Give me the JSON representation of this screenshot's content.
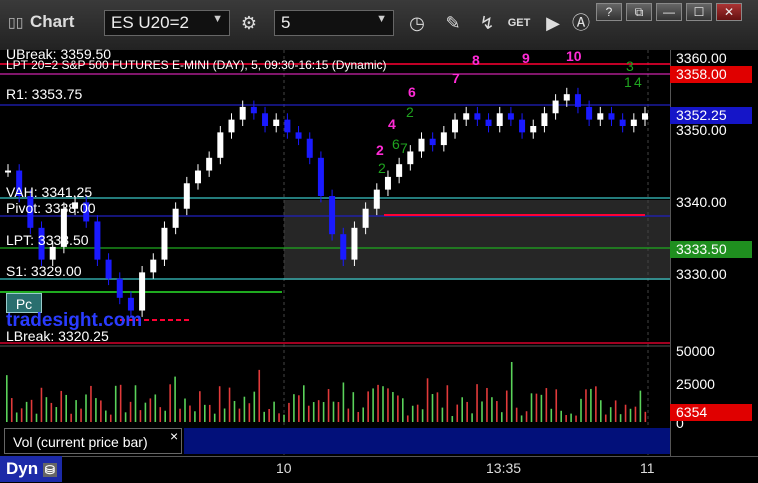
{
  "window": {
    "title": "Chart",
    "symbol": "ES U20=2",
    "interval": "5"
  },
  "toolbar_icons": [
    "settings-icon",
    "clock-icon",
    "pencil-icon",
    "indicator-icon",
    "get-icon",
    "play-icon",
    "alert-icon"
  ],
  "window_buttons": [
    "restore-icon",
    "pin-icon",
    "maximize-icon",
    "close-icon"
  ],
  "colors": {
    "background": "#000000",
    "up_bar": "#ffffff",
    "down_bar": "#1a1aff",
    "level_blue": "#2020c0",
    "level_cyan": "#39c6c6",
    "level_red": "#ff0033",
    "level_green": "#1faa1f",
    "magenta": "#ff2bd6",
    "green_count": "#1fa31f"
  },
  "header_text": "LPT 20=2 S&P 500 FUTURES E-MINI (DAY), 5, 09:30-16:15 (Dynamic)",
  "level_labels": {
    "ubreak": "UBreak: 3359.50",
    "upt": "UPT: 3358.00",
    "r1": "R1: 3353.75",
    "vah": "VAH: 3341.25",
    "pivot": "Pivot: 3338.00",
    "lpt": "LPT: 3333.50",
    "s1": "S1: 3329.00",
    "lbreak": "LBreak: 3320.25"
  },
  "price_axis": {
    "ticks": [
      "3360.00",
      "3350.00",
      "3340.00",
      "3330.00"
    ],
    "vol_ticks": [
      "50000",
      "25000",
      "0"
    ]
  },
  "price_boxes": {
    "last_red": "3358.00",
    "current": "3352.25",
    "green": "3333.50",
    "vol": "6354"
  },
  "markers": {
    "magenta_top": [
      "7",
      "8",
      "9",
      "10"
    ],
    "magenta_left": [
      "2",
      "4",
      "6"
    ],
    "green_left": [
      "2",
      "2",
      "6",
      "7"
    ],
    "green_right": [
      "3",
      "1",
      "4"
    ]
  },
  "pc_button": "Pc",
  "watermark": "tradesight.com",
  "volume_header": "Vol (current price bar)",
  "close_x": "×",
  "bottom": {
    "dyn": "Dyn",
    "x_labels": [
      "10",
      "13:35",
      "11"
    ]
  },
  "chart_data": {
    "type": "candlestick",
    "title": "ES U20=2 S&P 500 FUTURES E-MINI (DAY), 5, 09:30-16:15",
    "ylim": [
      3318,
      3362
    ],
    "levels": [
      {
        "name": "UBreak",
        "value": 3359.5
      },
      {
        "name": "UPT",
        "value": 3358.0
      },
      {
        "name": "R1",
        "value": 3353.75
      },
      {
        "name": "VAH",
        "value": 3341.25
      },
      {
        "name": "Pivot",
        "value": 3338.0
      },
      {
        "name": "LPT",
        "value": 3333.5
      },
      {
        "name": "S1",
        "value": 3329.0
      },
      {
        "name": "LBreak",
        "value": 3320.25
      }
    ],
    "closes": [
      3344,
      3340,
      3335,
      3330,
      3332,
      3338,
      3339,
      3336,
      3330,
      3327,
      3324,
      3322,
      3328,
      3330,
      3335,
      3338,
      3342,
      3344,
      3346,
      3350,
      3352,
      3354,
      3353,
      3351,
      3352,
      3350,
      3349,
      3346,
      3340,
      3334,
      3330,
      3335,
      3338,
      3341,
      3343,
      3345,
      3347,
      3349,
      3348,
      3350,
      3352,
      3353,
      3352,
      3351,
      3353,
      3352,
      3350,
      3351,
      3353,
      3355,
      3356,
      3354,
      3352,
      3353,
      3352,
      3351,
      3352,
      3353
    ],
    "volume_ylim": [
      0,
      50000
    ]
  }
}
